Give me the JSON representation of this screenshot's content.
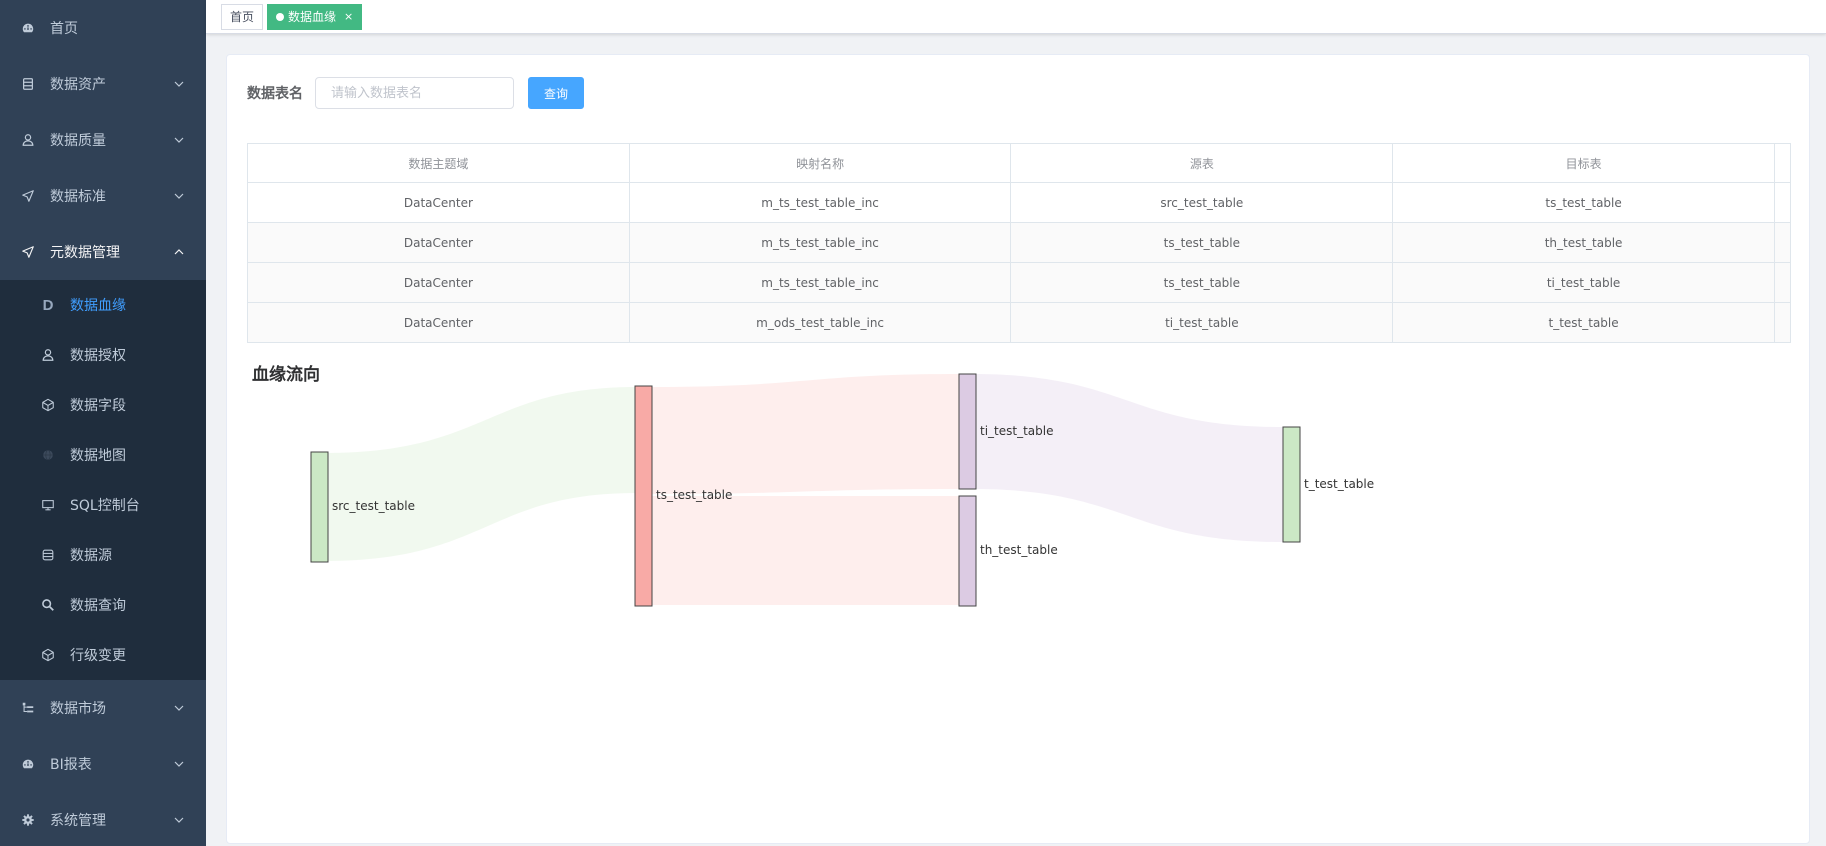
{
  "sidebar": {
    "items": [
      {
        "label": "首页",
        "icon": "dashboard-icon",
        "has_arrow": false
      },
      {
        "label": "数据资产",
        "icon": "database-icon",
        "has_arrow": true
      },
      {
        "label": "数据质量",
        "icon": "user-icon",
        "has_arrow": true
      },
      {
        "label": "数据标准",
        "icon": "send-icon",
        "has_arrow": true
      },
      {
        "label": "元数据管理",
        "icon": "send-icon",
        "has_arrow": true,
        "open": true
      }
    ],
    "subitems": [
      {
        "label": "数据血缘",
        "icon": "d-letter-icon",
        "active": true
      },
      {
        "label": "数据授权",
        "icon": "user-icon"
      },
      {
        "label": "数据字段",
        "icon": "cube-icon"
      },
      {
        "label": "数据地图",
        "icon": "globe-icon"
      },
      {
        "label": "SQL控制台",
        "icon": "monitor-icon"
      },
      {
        "label": "数据源",
        "icon": "server-icon"
      },
      {
        "label": "数据查询",
        "icon": "search-icon"
      },
      {
        "label": "行级变更",
        "icon": "cube-icon"
      }
    ],
    "bottom_items": [
      {
        "label": "数据市场",
        "icon": "tree-icon",
        "has_arrow": true
      },
      {
        "label": "BI报表",
        "icon": "dashboard-icon",
        "has_arrow": true
      },
      {
        "label": "系统管理",
        "icon": "gear-icon",
        "has_arrow": true
      }
    ]
  },
  "tags": {
    "home": "首页",
    "active": "数据血缘",
    "close": "×"
  },
  "search": {
    "label": "数据表名",
    "placeholder": "请输入数据表名",
    "value": "",
    "button": "查询"
  },
  "table": {
    "headers": [
      "数据主题域",
      "映射名称",
      "源表",
      "目标表"
    ],
    "rows": [
      [
        "DataCenter",
        "m_ts_test_table_inc",
        "src_test_table",
        "ts_test_table"
      ],
      [
        "DataCenter",
        "m_ts_test_table_inc",
        "ts_test_table",
        "th_test_table"
      ],
      [
        "DataCenter",
        "m_ts_test_table_inc",
        "ts_test_table",
        "ti_test_table"
      ],
      [
        "DataCenter",
        "m_ods_test_table_inc",
        "ti_test_table",
        "t_test_table"
      ]
    ]
  },
  "lineage": {
    "title": "血缘流向",
    "nodes": [
      {
        "name": "src_test_table",
        "color": "#cbe8c5"
      },
      {
        "name": "ts_test_table",
        "color": "#f8aaa6"
      },
      {
        "name": "ti_test_table",
        "color": "#dccbe3"
      },
      {
        "name": "th_test_table",
        "color": "#dccbe3"
      },
      {
        "name": "t_test_table",
        "color": "#cbe8c5"
      }
    ],
    "links": [
      {
        "source": "src_test_table",
        "target": "ts_test_table",
        "value": 1
      },
      {
        "source": "ts_test_table",
        "target": "ti_test_table",
        "value": 1
      },
      {
        "source": "ts_test_table",
        "target": "th_test_table",
        "value": 1
      },
      {
        "source": "ti_test_table",
        "target": "t_test_table",
        "value": 1
      }
    ]
  },
  "colors": {
    "sidebar_bg": "#304156",
    "submenu_bg": "#1f2d3d",
    "active": "#409eff",
    "tag_active": "#42b983",
    "button": "#46a6ff"
  }
}
